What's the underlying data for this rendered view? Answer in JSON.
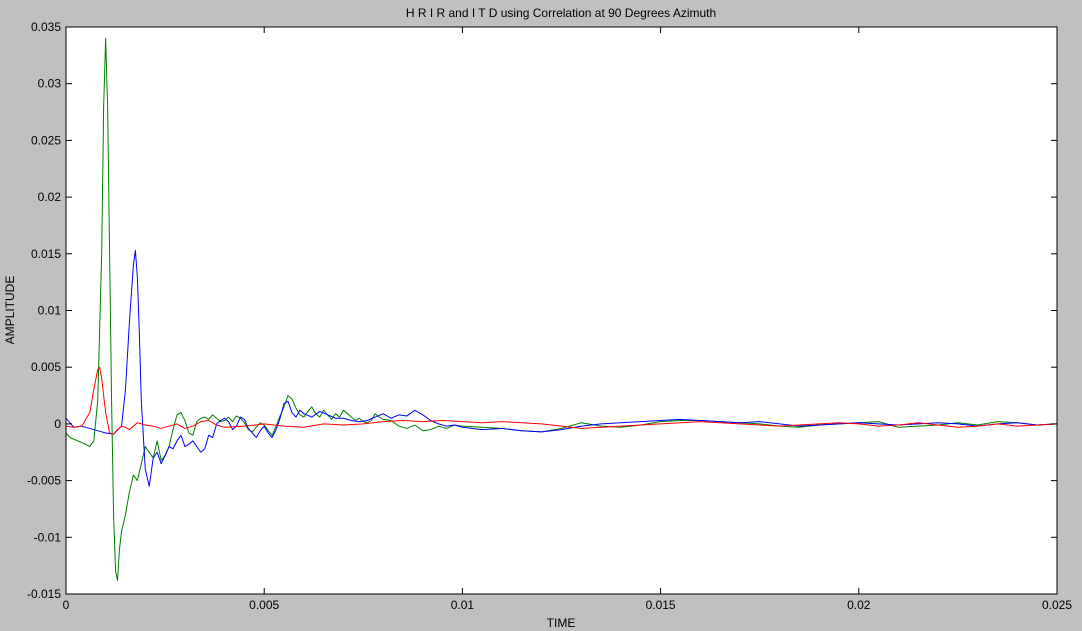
{
  "chart_data": {
    "type": "line",
    "title": "H R I R  and I T D using Correlation at 90 Degrees Azimuth",
    "xlabel": "TIME",
    "ylabel": "AMPLITUDE",
    "xlim": [
      0,
      0.025
    ],
    "ylim": [
      -0.015,
      0.035
    ],
    "xticks": [
      0,
      0.005,
      0.01,
      0.015,
      0.02,
      0.025
    ],
    "xtick_labels": [
      "0",
      "0.005",
      "0.01",
      "0.015",
      "0.02",
      "0.025"
    ],
    "yticks": [
      -0.015,
      -0.01,
      -0.005,
      0,
      0.005,
      0.01,
      0.015,
      0.02,
      0.025,
      0.03,
      0.035
    ],
    "ytick_labels": [
      "-0.015",
      "-0.01",
      "-0.005",
      "0",
      "0.005",
      "0.01",
      "0.015",
      "0.02",
      "0.025",
      "0.03",
      "0.035"
    ],
    "grid": false,
    "legend": "none",
    "series": [
      {
        "color": "#008000",
        "x": [
          0,
          0.0001,
          0.0003,
          0.0005,
          0.0006,
          0.0007,
          0.0008,
          0.0009,
          0.00095,
          0.001,
          0.00105,
          0.0011,
          0.00115,
          0.0012,
          0.00125,
          0.0013,
          0.00135,
          0.0014,
          0.0015,
          0.0016,
          0.0017,
          0.0018,
          0.0019,
          0.002,
          0.0021,
          0.0022,
          0.0023,
          0.0024,
          0.0025,
          0.0026,
          0.0027,
          0.0028,
          0.0029,
          0.003,
          0.0031,
          0.0032,
          0.0033,
          0.0034,
          0.0035,
          0.0036,
          0.0037,
          0.0038,
          0.0039,
          0.004,
          0.0041,
          0.0042,
          0.0043,
          0.0044,
          0.0045,
          0.0046,
          0.0047,
          0.0048,
          0.0049,
          0.005,
          0.0051,
          0.0052,
          0.0053,
          0.0054,
          0.0055,
          0.0056,
          0.0057,
          0.0058,
          0.0059,
          0.006,
          0.0061,
          0.0062,
          0.0063,
          0.0064,
          0.0065,
          0.0066,
          0.0067,
          0.0068,
          0.0069,
          0.007,
          0.0071,
          0.0072,
          0.0073,
          0.0074,
          0.0075,
          0.0076,
          0.0077,
          0.0078,
          0.0079,
          0.008,
          0.0082,
          0.0084,
          0.0086,
          0.0088,
          0.009,
          0.0092,
          0.0094,
          0.0096,
          0.0098,
          0.01,
          0.0105,
          0.011,
          0.0115,
          0.012,
          0.0125,
          0.013,
          0.0135,
          0.014,
          0.0145,
          0.015,
          0.0155,
          0.016,
          0.0165,
          0.017,
          0.0175,
          0.018,
          0.0185,
          0.019,
          0.0195,
          0.02,
          0.0205,
          0.021,
          0.0215,
          0.022,
          0.0225,
          0.023,
          0.0235,
          0.024,
          0.0245,
          0.025
        ],
        "y": [
          -0.0008,
          -0.0012,
          -0.0015,
          -0.0018,
          -0.002,
          -0.0015,
          0.002,
          0.015,
          0.028,
          0.034,
          0.028,
          0.015,
          0.002,
          -0.008,
          -0.013,
          -0.0138,
          -0.011,
          -0.0095,
          -0.008,
          -0.006,
          -0.0045,
          -0.005,
          -0.0035,
          -0.002,
          -0.0025,
          -0.003,
          -0.0015,
          -0.0032,
          -0.0028,
          -0.002,
          -0.0005,
          0.0008,
          0.001,
          0.0003,
          -0.0008,
          -0.001,
          0.0002,
          0.0005,
          0.0006,
          0.0004,
          0.0008,
          0.0005,
          0.0002,
          0.0003,
          0.0006,
          0.0002,
          0.0007,
          0.0005,
          0.0001,
          -0.0005,
          -0.0007,
          -0.0003,
          0.0001,
          -0.0001,
          -0.0006,
          -0.001,
          -0.0002,
          0.0007,
          0.0015,
          0.0025,
          0.0022,
          0.0014,
          0.0008,
          0.0006,
          0.0011,
          0.0015,
          0.0009,
          0.0006,
          0.0012,
          0.0008,
          0.0004,
          0.0009,
          0.0006,
          0.0012,
          0.0009,
          0.0006,
          0.0003,
          0.0005,
          0.0002,
          0.0001,
          0.0003,
          0.0009,
          0.0006,
          0.0004,
          0.0003,
          -0.0002,
          -0.0004,
          -0.0001,
          -0.0006,
          -0.0005,
          -0.0002,
          -0.0004,
          -0.0001,
          -0.0002,
          -0.0003,
          -0.0004,
          -0.0006,
          -0.0007,
          -0.0004,
          0.0001,
          -0.0002,
          -0.0003,
          -0.0001,
          0.0002,
          0.0003,
          0.0003,
          0.0002,
          0.0001,
          0,
          -0.0002,
          -0.0003,
          -0.0001,
          0,
          0.0001,
          0.0002,
          -0.0003,
          -0.0002,
          -0.0001,
          0.0001,
          -0.0001,
          0.0002,
          0.0001,
          -0.0001,
          0
        ]
      },
      {
        "color": "#0000ff",
        "x": [
          0,
          0.0002,
          0.0004,
          0.0006,
          0.0008,
          0.001,
          0.0012,
          0.0014,
          0.0015,
          0.0016,
          0.0017,
          0.00175,
          0.0018,
          0.00185,
          0.0019,
          0.002,
          0.0021,
          0.0022,
          0.0023,
          0.0024,
          0.0025,
          0.0026,
          0.0027,
          0.0028,
          0.0029,
          0.003,
          0.0031,
          0.0032,
          0.0033,
          0.0034,
          0.0035,
          0.0036,
          0.0037,
          0.0038,
          0.0039,
          0.004,
          0.0041,
          0.0042,
          0.0043,
          0.0044,
          0.0045,
          0.0046,
          0.0047,
          0.0048,
          0.0049,
          0.005,
          0.0051,
          0.0052,
          0.0053,
          0.0054,
          0.0055,
          0.0056,
          0.0057,
          0.0058,
          0.0059,
          0.006,
          0.0062,
          0.0064,
          0.0066,
          0.0068,
          0.007,
          0.0072,
          0.0074,
          0.0076,
          0.0078,
          0.008,
          0.0082,
          0.0084,
          0.0086,
          0.0088,
          0.009,
          0.0092,
          0.0094,
          0.0096,
          0.0098,
          0.01,
          0.0105,
          0.011,
          0.0115,
          0.012,
          0.0125,
          0.013,
          0.0135,
          0.014,
          0.0145,
          0.015,
          0.0155,
          0.016,
          0.0165,
          0.017,
          0.0175,
          0.018,
          0.0185,
          0.019,
          0.0195,
          0.02,
          0.0205,
          0.021,
          0.0215,
          0.022,
          0.0225,
          0.023,
          0.0235,
          0.024,
          0.0245,
          0.025
        ],
        "y": [
          0.0005,
          -0.0003,
          -0.0002,
          -0.0004,
          -0.0006,
          -0.0008,
          -0.0009,
          -0.0002,
          0.003,
          0.009,
          0.014,
          0.0153,
          0.013,
          0.008,
          0.002,
          -0.004,
          -0.0055,
          -0.003,
          -0.0025,
          -0.0035,
          -0.0028,
          -0.002,
          -0.0022,
          -0.0015,
          -0.001,
          -0.002,
          -0.0018,
          -0.0015,
          -0.002,
          -0.0025,
          -0.0022,
          -0.001,
          -0.0012,
          0,
          0.0003,
          0.0005,
          0.0002,
          -0.0005,
          -0.0002,
          0.0006,
          0.0004,
          -0.0004,
          -0.0008,
          -0.0012,
          -0.0006,
          -0.0002,
          -0.0008,
          -0.0012,
          -0.0005,
          0.0005,
          0.0018,
          0.002,
          0.001,
          0.0006,
          0.0012,
          0.0009,
          0.0006,
          0.0011,
          0.0008,
          0.0005,
          0.0005,
          0.0003,
          0.0002,
          0.0003,
          0.0006,
          0.0009,
          0.0005,
          0.0008,
          0.0007,
          0.0012,
          0.0008,
          0.0003,
          0,
          -0.0002,
          -0.0001,
          -0.0003,
          -0.0005,
          -0.0004,
          -0.0006,
          -0.0007,
          -0.0005,
          -0.0002,
          0,
          0.0001,
          0.0002,
          0.0003,
          0.0004,
          0.0003,
          0.0002,
          0.0001,
          0.0002,
          0,
          -0.0002,
          -0.0001,
          0,
          0.0001,
          0,
          -0.0001,
          0,
          0.0001,
          0,
          -0.0002,
          0,
          0.0001,
          -0.0001,
          0
        ]
      },
      {
        "color": "#ff0000",
        "x": [
          0,
          0.0002,
          0.0004,
          0.0006,
          0.0007,
          0.0008,
          0.00085,
          0.0009,
          0.001,
          0.0011,
          0.0012,
          0.0013,
          0.0014,
          0.0015,
          0.0016,
          0.0017,
          0.0018,
          0.002,
          0.0022,
          0.0024,
          0.0026,
          0.0028,
          0.003,
          0.0032,
          0.0034,
          0.0036,
          0.0038,
          0.004,
          0.0045,
          0.005,
          0.0055,
          0.006,
          0.0065,
          0.007,
          0.0075,
          0.008,
          0.0085,
          0.009,
          0.0095,
          0.01,
          0.0105,
          0.011,
          0.0115,
          0.012,
          0.0125,
          0.013,
          0.0135,
          0.014,
          0.0145,
          0.015,
          0.0155,
          0.016,
          0.0165,
          0.017,
          0.0175,
          0.018,
          0.0185,
          0.019,
          0.0195,
          0.02,
          0.0205,
          0.021,
          0.0215,
          0.022,
          0.0225,
          0.023,
          0.0235,
          0.024,
          0.0245,
          0.025
        ],
        "y": [
          -0.0002,
          -0.0003,
          -0.0002,
          0.001,
          0.003,
          0.0048,
          0.005,
          0.004,
          0.001,
          -0.0008,
          -0.0009,
          -0.0005,
          -0.0002,
          -0.0003,
          -0.0005,
          -0.0002,
          0.0001,
          -0.0001,
          -0.0002,
          -0.0004,
          -0.0002,
          0,
          -0.0004,
          -0.0002,
          0.0002,
          0.0003,
          -0.0001,
          -0.0003,
          -0.0002,
          0,
          -0.0002,
          -0.0003,
          0,
          -0.0001,
          0,
          0.0002,
          0.0003,
          0.0002,
          0.0003,
          0.0002,
          0.0001,
          0.0002,
          0.0001,
          0,
          -0.0002,
          -0.0004,
          -0.0003,
          -0.0002,
          -0.0001,
          0,
          0.0001,
          0.0002,
          0.0001,
          0,
          -0.0001,
          -0.0002,
          -0.0001,
          0,
          0.0001,
          0,
          -0.0002,
          -0.0001,
          0.0001,
          -0.0001,
          -0.0003,
          -0.0002,
          0,
          -0.0002,
          -0.0001,
          0
        ]
      }
    ]
  }
}
